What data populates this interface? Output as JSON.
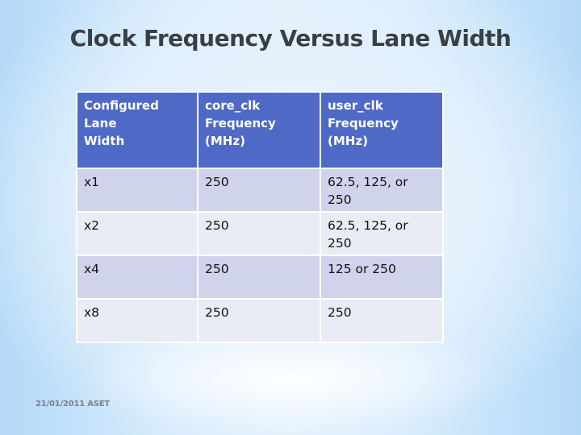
{
  "slide": {
    "title": "Clock Frequency Versus Lane Width",
    "footer": "21/01/2011 ASET"
  },
  "table": {
    "headers": [
      {
        "line1": "Configured Lane",
        "line2": "Width"
      },
      {
        "line1": "core_clk",
        "line2": "Frequency (MHz)"
      },
      {
        "line1": "user_clk",
        "line2": "Frequency (MHz)"
      }
    ],
    "rows": [
      {
        "lane_width": "x1",
        "core_clk": "250",
        "user_clk": "62.5, 125, or 250"
      },
      {
        "lane_width": "x2",
        "core_clk": "250",
        "user_clk": "62.5, 125, or 250"
      },
      {
        "lane_width": "x4",
        "core_clk": "250",
        "user_clk": "125 or 250"
      },
      {
        "lane_width": "x8",
        "core_clk": "250",
        "user_clk": "250"
      }
    ]
  },
  "colors": {
    "header_bg": "#4f69c6",
    "row_odd_bg": "#d0d3ec",
    "row_even_bg": "#e9ebf5",
    "title_color": "#3a3f46"
  }
}
